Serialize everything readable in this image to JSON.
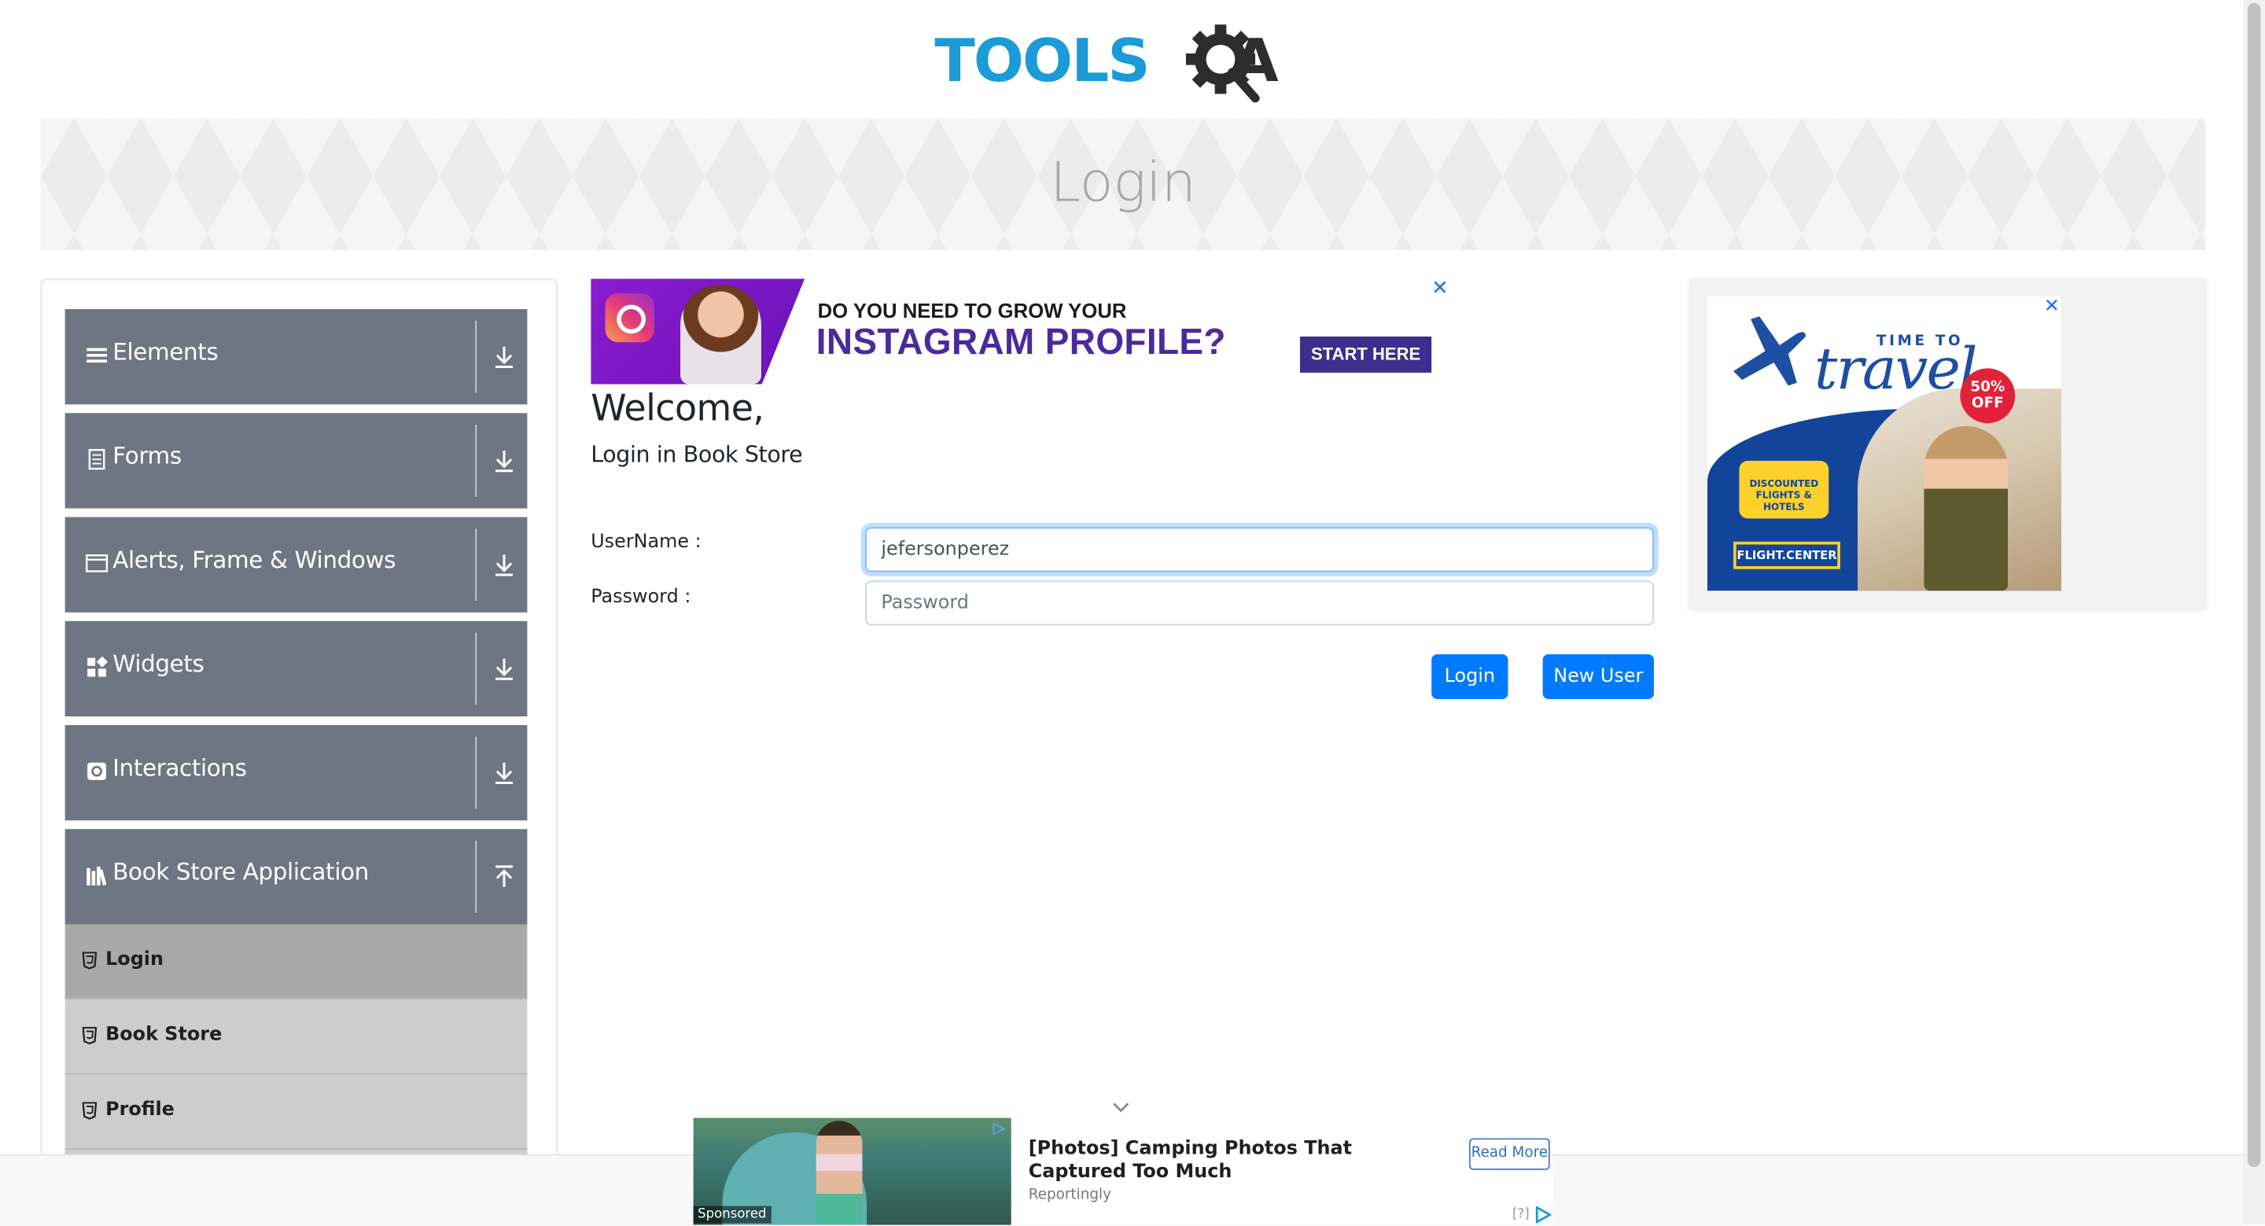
{
  "header": {
    "logo_tools": "TOOLS",
    "logo_a": "A",
    "banner_title": "Login"
  },
  "colors": {
    "brand_blue": "#1b9bd7",
    "primary_button": "#007bff",
    "sidebar_group": "#6e7681",
    "sidebar_subitem": "#cdcdcd",
    "sidebar_subitem_active": "#a9a9a9"
  },
  "sidebar": {
    "groups": [
      {
        "label": "Elements",
        "icon": "hamburger-icon",
        "arrow": "download-arrow-icon"
      },
      {
        "label": "Forms",
        "icon": "form-list-icon",
        "arrow": "download-arrow-icon"
      },
      {
        "label": "Alerts, Frame & Windows",
        "icon": "window-icon",
        "arrow": "download-arrow-icon"
      },
      {
        "label": "Widgets",
        "icon": "widgets-grid-icon",
        "arrow": "download-arrow-icon"
      },
      {
        "label": "Interactions",
        "icon": "interactions-icon",
        "arrow": "download-arrow-icon"
      },
      {
        "label": "Book Store Application",
        "icon": "books-icon",
        "arrow": "upload-arrow-icon"
      }
    ],
    "book_store_items": [
      {
        "label": "Login",
        "icon": "html5-icon",
        "active": true
      },
      {
        "label": "Book Store",
        "icon": "html5-icon",
        "active": false
      },
      {
        "label": "Profile",
        "icon": "html5-icon",
        "active": false
      }
    ]
  },
  "ad_top": {
    "line1": "DO YOU NEED TO GROW YOUR",
    "line2": "INSTAGRAM PROFILE?",
    "cta": "START HERE",
    "close": "✕"
  },
  "login": {
    "welcome": "Welcome,",
    "subtitle": "Login in Book Store",
    "username_label": "UserName :",
    "username_value": "jefersonperez",
    "password_label": "Password :",
    "password_placeholder": "Password",
    "login_button": "Login",
    "new_user_button": "New User"
  },
  "ad_right": {
    "time_to": "TIME TO",
    "travel": "travel",
    "badge": "50% OFF",
    "promo": "DISCOUNTED FLIGHTS & HOTELS",
    "brand": "FLIGHT.CENTER",
    "close": "✕"
  },
  "ad_bottom": {
    "headline": "[Photos] Camping Photos That Captured Too Much",
    "source": "Reportingly",
    "read_more": "Read More",
    "sponsored": "Sponsored",
    "help": "[?]"
  }
}
